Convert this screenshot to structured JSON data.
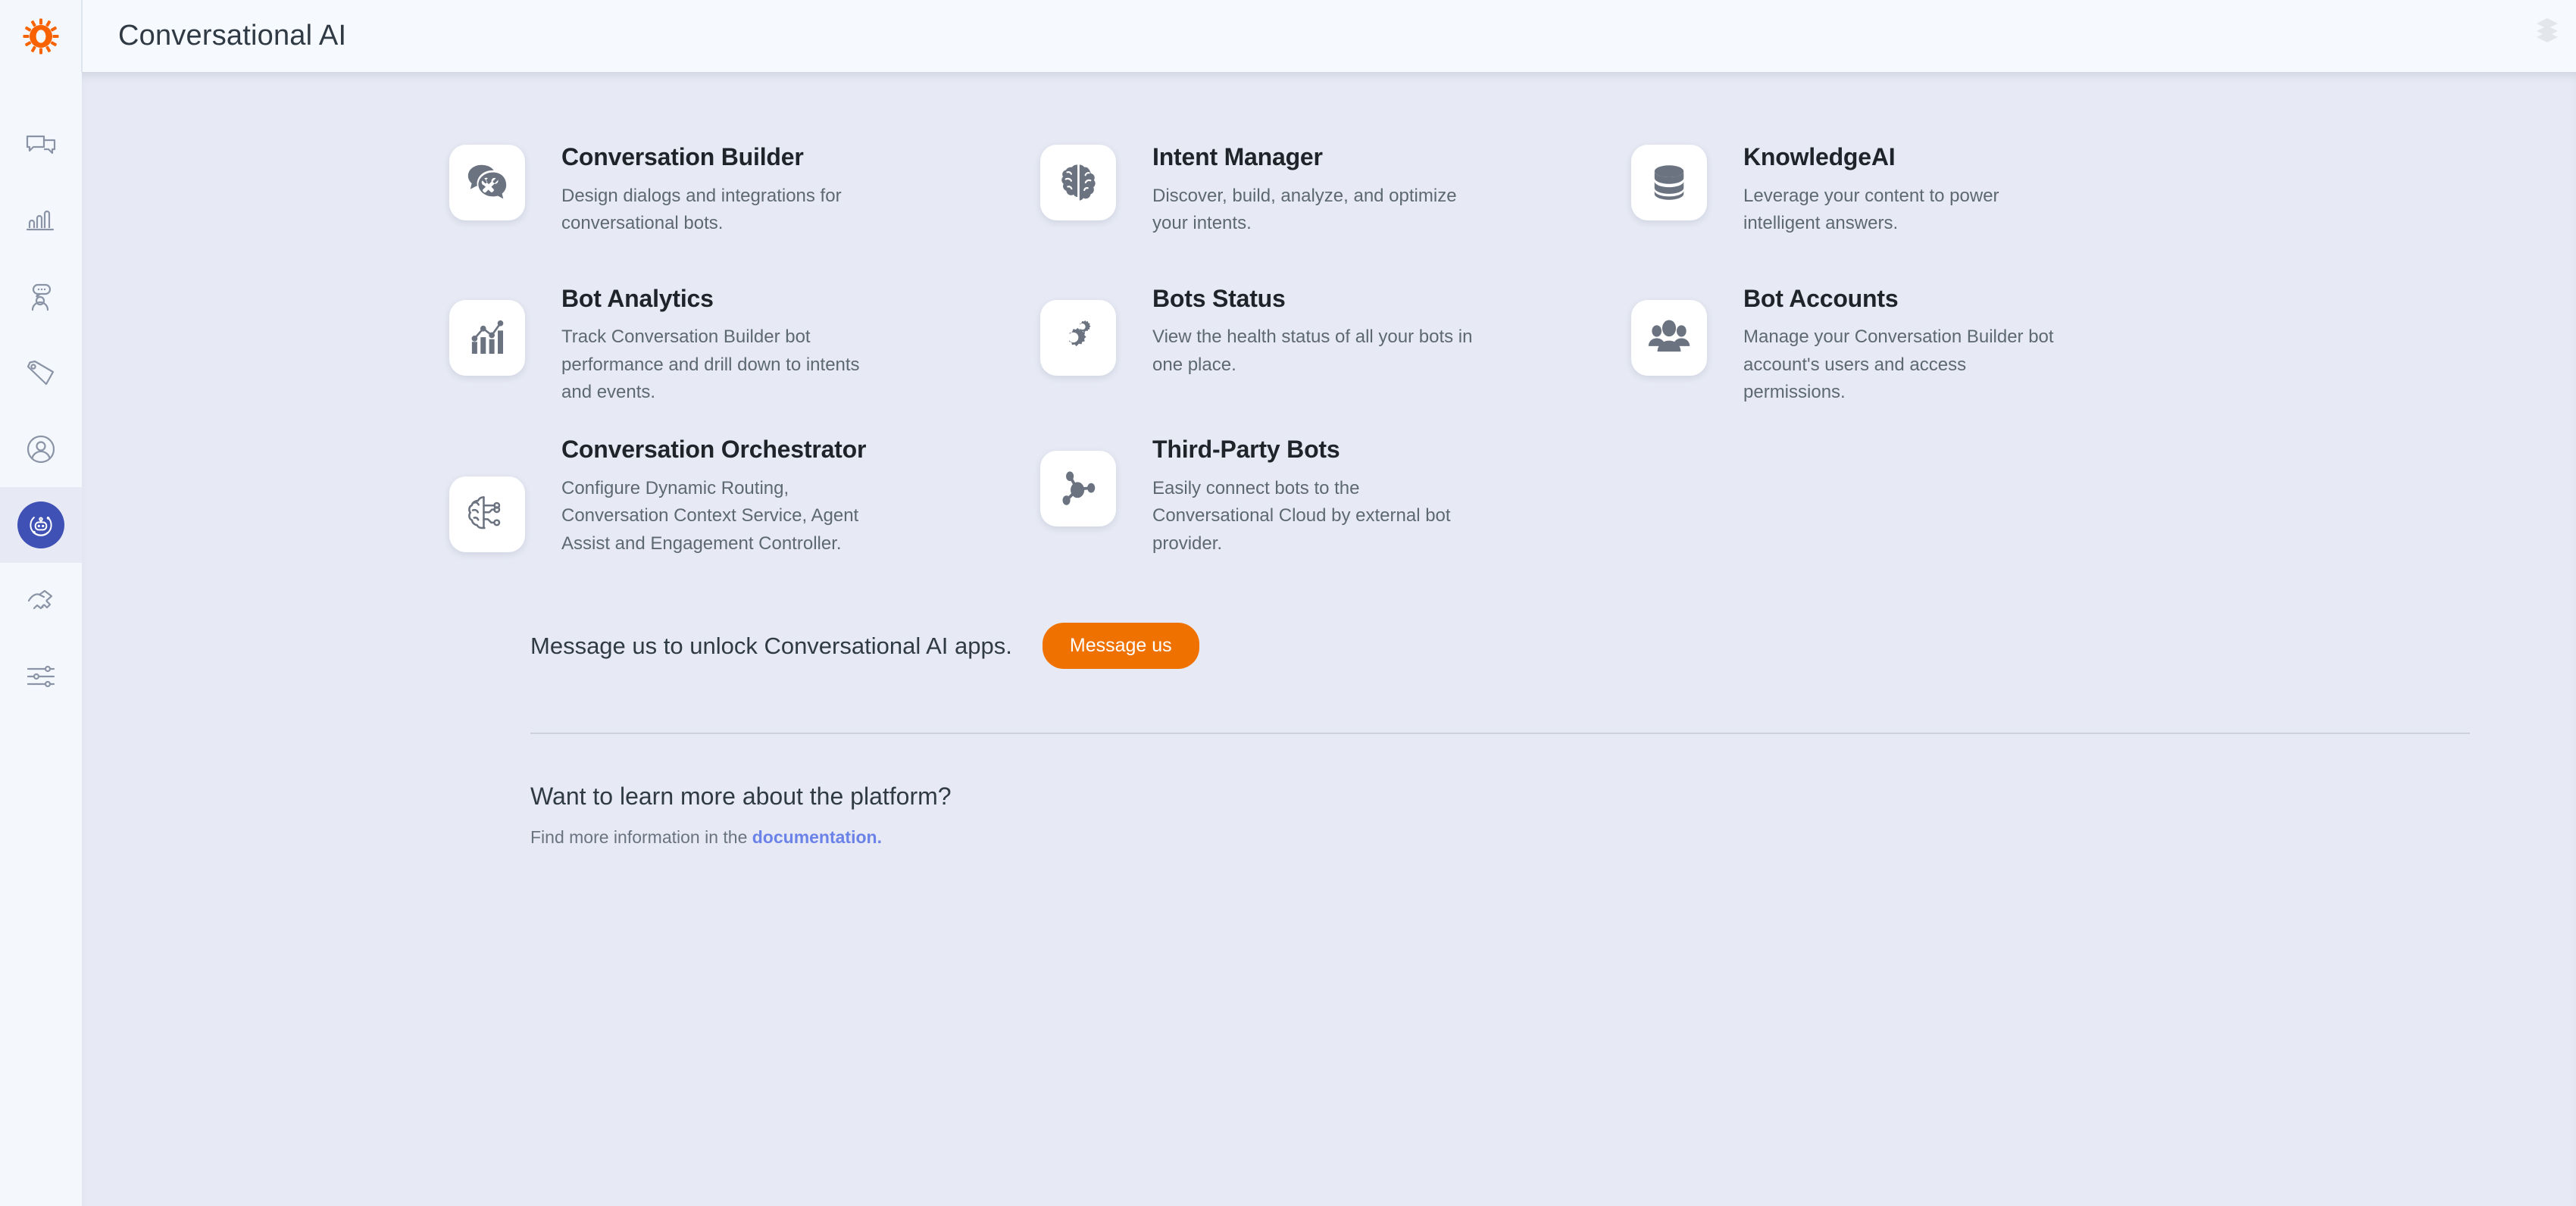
{
  "header": {
    "title": "Conversational AI",
    "logo_icon": "gear-logo-icon",
    "right_icon": "layers-icon"
  },
  "colors": {
    "brand_orange": "#ef7100",
    "active_blue": "#3f51b5",
    "content_bg": "#e7eaf4",
    "sidebar_bg": "#f4f8fc",
    "link_blue": "#6b82e8",
    "icon_gray": "#6b7280"
  },
  "sidebar": {
    "items": [
      {
        "name": "sidebar-item-messaging",
        "icon": "chat-bubbles-icon",
        "active": false
      },
      {
        "name": "sidebar-item-analytics",
        "icon": "bar-chart-icon",
        "active": false
      },
      {
        "name": "sidebar-item-agent",
        "icon": "agent-chat-icon",
        "active": false
      },
      {
        "name": "sidebar-item-tags",
        "icon": "tag-icon",
        "active": false
      },
      {
        "name": "sidebar-item-users",
        "icon": "user-circle-icon",
        "active": false
      },
      {
        "name": "sidebar-item-bots",
        "icon": "bot-icon",
        "active": true
      },
      {
        "name": "sidebar-item-ai",
        "icon": "handshake-ai-icon",
        "active": false
      },
      {
        "name": "sidebar-item-settings",
        "icon": "sliders-icon",
        "active": false
      }
    ]
  },
  "apps": [
    {
      "title": "Conversation Builder",
      "desc": "Design dialogs and integrations for conversational bots.",
      "icon": "chat-tools-icon"
    },
    {
      "title": "Intent Manager",
      "desc": "Discover, build, analyze, and optimize your intents.",
      "icon": "brain-icon"
    },
    {
      "title": "KnowledgeAI",
      "desc": "Leverage your content to power intelligent answers.",
      "icon": "database-icon"
    },
    {
      "title": "Bot Analytics",
      "desc": "Track Conversation Builder bot performance and drill down to intents and events.",
      "icon": "chart-trend-icon"
    },
    {
      "title": "Bots Status",
      "desc": "View the health status of all your bots in one place.",
      "icon": "gears-icon"
    },
    {
      "title": "Bot Accounts",
      "desc": "Manage your Conversation Builder bot account's users and access permissions.",
      "icon": "people-group-icon"
    },
    {
      "title": "Conversation Orchestrator",
      "desc": "Configure Dynamic Routing, Conversation Context Service, Agent Assist and Engagement Controller.",
      "icon": "brain-circuit-icon"
    },
    {
      "title": "Third-Party Bots",
      "desc": "Easily connect bots to the Conversational Cloud by external bot provider.",
      "icon": "network-nodes-icon"
    }
  ],
  "cta": {
    "text": "Message us to unlock Conversational AI apps.",
    "button_label": "Message us"
  },
  "footer": {
    "title": "Want to learn more about the platform?",
    "sub_prefix": "Find more information in the ",
    "link_label": "documentation.",
    "sub_full": "Find more information in the documentation."
  }
}
